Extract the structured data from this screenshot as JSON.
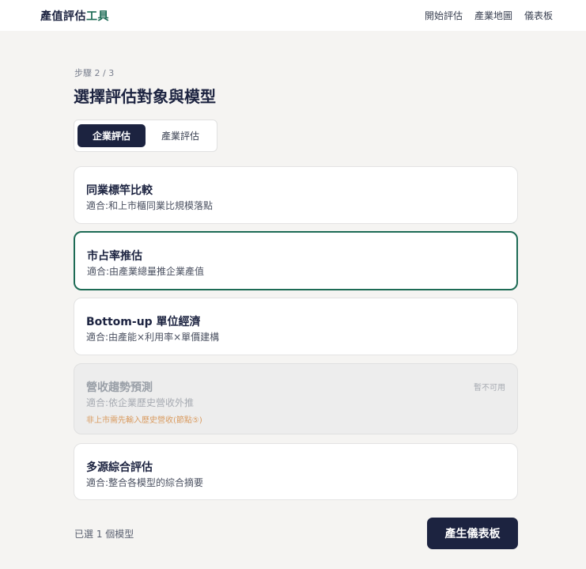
{
  "header": {
    "brand_main": "產值評估",
    "brand_accent": "工具",
    "nav": [
      "開始評估",
      "產業地圖",
      "儀表板"
    ]
  },
  "step": "步驟 2 / 3",
  "title": "選擇評估對象與模型",
  "tabs": [
    {
      "label": "企業評估",
      "active": true
    },
    {
      "label": "產業評估",
      "active": false
    }
  ],
  "models": [
    {
      "title": "同業標竿比較",
      "desc": "適合:和上市櫃同業比規模落點",
      "state": "normal"
    },
    {
      "title": "市占率推估",
      "desc": "適合:由產業總量推企業產值",
      "state": "selected"
    },
    {
      "title": "Bottom-up 單位經濟",
      "desc": "適合:由產能×利用率×單價建構",
      "state": "normal"
    },
    {
      "title": "營收趨勢預測",
      "desc": "適合:依企業歷史營收外推",
      "state": "disabled",
      "badge": "暫不可用",
      "warning": "非上市需先輸入歷史營收(節點⑤)"
    },
    {
      "title": "多源綜合評估",
      "desc": "適合:整合各模型的綜合摘要",
      "state": "normal"
    }
  ],
  "footer": {
    "selected_count": "已選 1 個模型",
    "generate_label": "產生儀表板"
  },
  "colors": {
    "primary": "#1c2340",
    "accent": "#1d6b55",
    "warning": "#d99a5e",
    "background": "#f5f4f2"
  }
}
